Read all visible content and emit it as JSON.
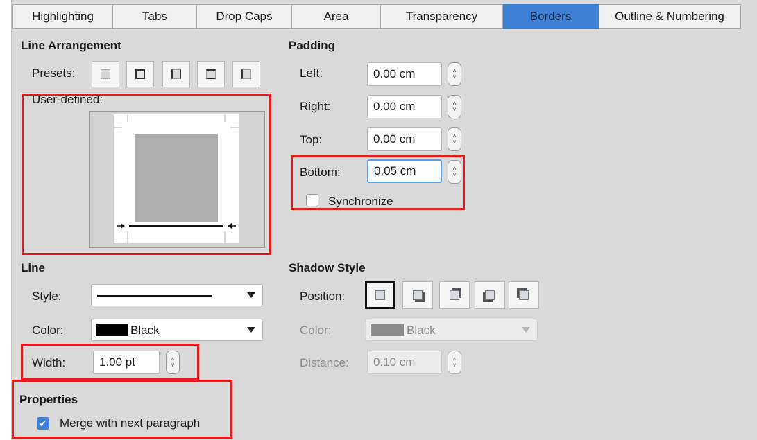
{
  "tabs": [
    {
      "label": "Highlighting"
    },
    {
      "label": "Tabs"
    },
    {
      "label": "Drop Caps"
    },
    {
      "label": "Area"
    },
    {
      "label": "Transparency"
    },
    {
      "label": "Borders",
      "active": true
    },
    {
      "label": "Outline & Numbering"
    }
  ],
  "line_arrangement": {
    "heading": "Line Arrangement",
    "presets_label": "Presets:",
    "user_defined_label": "User-defined:"
  },
  "padding": {
    "heading": "Padding",
    "left_label": "Left:",
    "left_value": "0.00 cm",
    "right_label": "Right:",
    "right_value": "0.00 cm",
    "top_label": "Top:",
    "top_value": "0.00 cm",
    "bottom_label": "Bottom:",
    "bottom_value": "0.05 cm",
    "synchronize_label": "Synchronize",
    "synchronize_checked": false
  },
  "line": {
    "heading": "Line",
    "style_label": "Style:",
    "color_label": "Color:",
    "color_value": "Black",
    "color_swatch": "#000000",
    "width_label": "Width:",
    "width_value": "1.00 pt"
  },
  "shadow_style": {
    "heading": "Shadow Style",
    "position_label": "Position:",
    "color_label": "Color:",
    "color_value": "Black",
    "color_swatch": "#8c8c8c",
    "distance_label": "Distance:",
    "distance_value": "0.10 cm"
  },
  "properties": {
    "heading": "Properties",
    "merge_label": "Merge with next paragraph",
    "merge_checked": true
  },
  "colors": {
    "dialog_bg": "#d9d9d9",
    "active_tab": "#3e80d6",
    "highlight_red": "#e41b1b"
  }
}
